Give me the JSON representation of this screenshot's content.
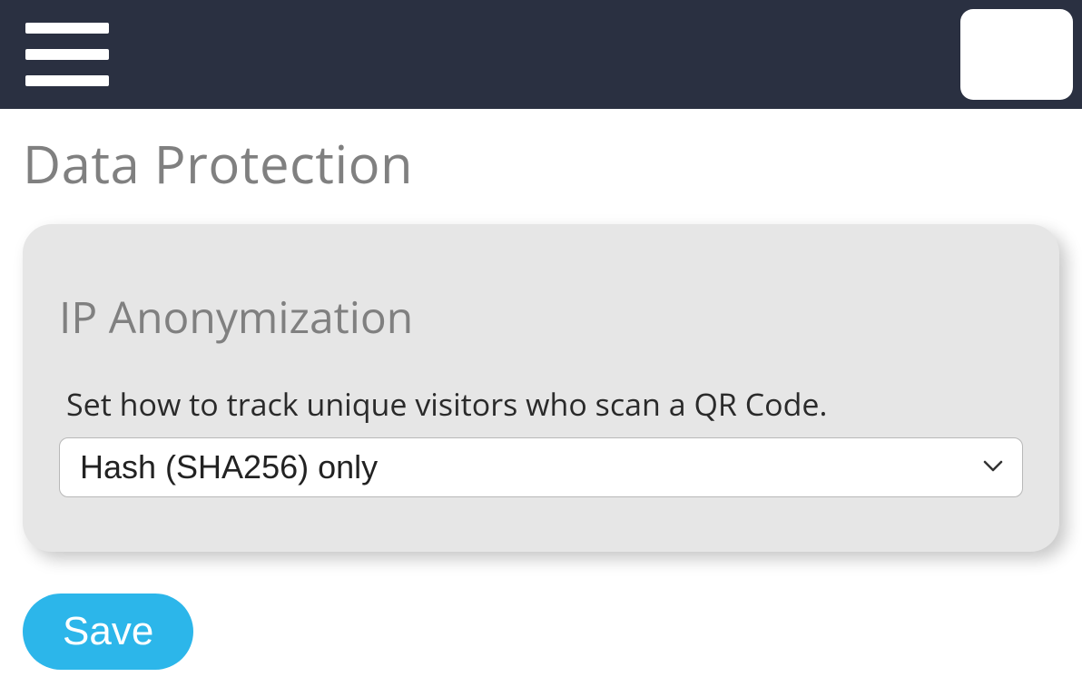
{
  "page": {
    "title": "Data Protection"
  },
  "card": {
    "title": "IP Anonymization",
    "field_label": "Set how to track unique visitors who scan a QR Code.",
    "select_value": "Hash (SHA256) only"
  },
  "actions": {
    "save_label": "Save"
  },
  "header": {
    "icons": {
      "menu": "hamburger-icon",
      "right": "header-button"
    }
  },
  "colors": {
    "header_bg": "#2a3041",
    "card_bg": "#e6e6e6",
    "accent": "#2cb6ea",
    "muted_text": "#808080"
  }
}
